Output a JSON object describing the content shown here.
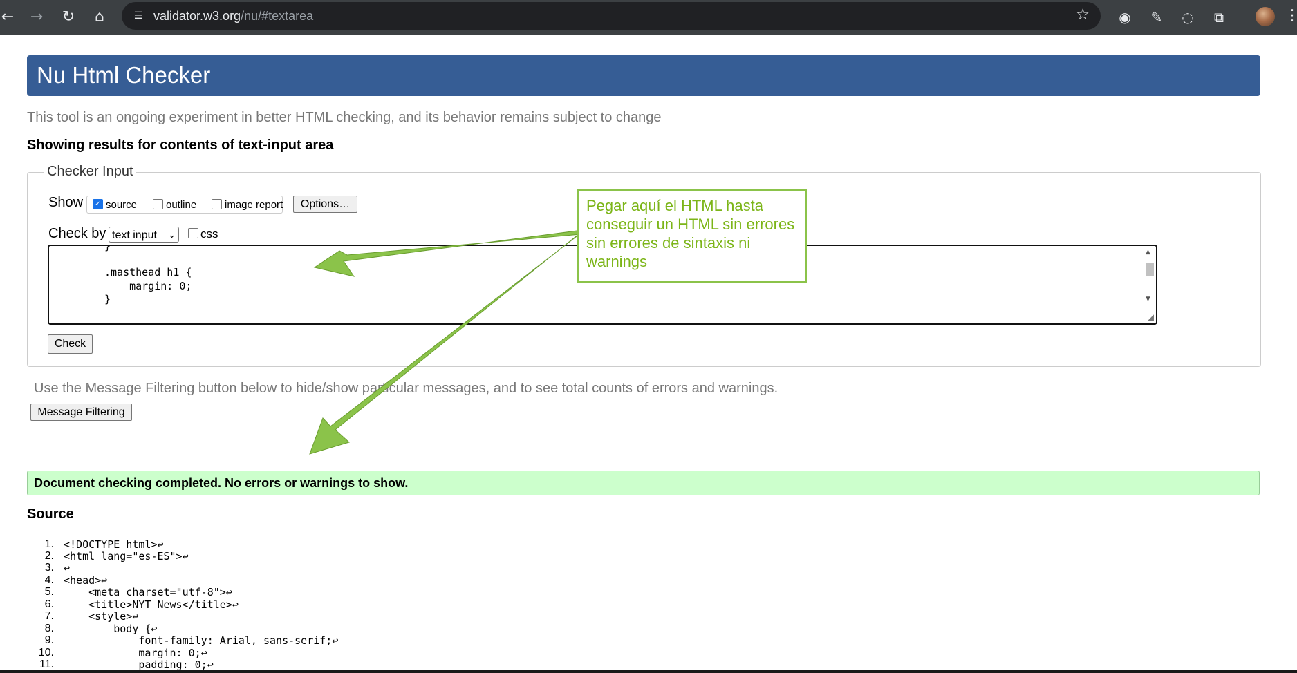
{
  "browser": {
    "url_domain": "validator.w3.org",
    "url_path": "/nu/#textarea",
    "icons": [
      "back-icon",
      "forward-icon",
      "reload-icon",
      "home-icon",
      "site-info-icon",
      "bookmark-star-icon",
      "camera-icon",
      "eyedropper-icon",
      "sync-icon",
      "extensions-icon",
      "profile-avatar",
      "menu-dots-icon"
    ]
  },
  "header": {
    "title": "Nu Html Checker"
  },
  "intro_text": "This tool is an ongoing experiment in better HTML checking, and its behavior remains subject to change",
  "results_heading": "Showing results for contents of text-input area",
  "checker_input": {
    "legend": "Checker Input",
    "show_label": "Show",
    "options": [
      {
        "label": "source",
        "checked": true
      },
      {
        "label": "outline",
        "checked": false
      },
      {
        "label": "image report",
        "checked": false
      }
    ],
    "options_button": "Options…",
    "check_by_label": "Check by",
    "check_by_value": "text input",
    "css_label": "css",
    "css_checked": false,
    "textarea_lines": [
      "}",
      "",
      ".masthead h1 {",
      "    margin: 0;",
      "}"
    ],
    "check_button": "Check"
  },
  "filter_text": "Use the Message Filtering button below to hide/show particular messages, and to see total counts of errors and warnings.",
  "message_filtering_button": "Message Filtering",
  "success_message": "Document checking completed. No errors or warnings to show.",
  "source_heading": "Source",
  "source_lines": [
    {
      "num": "1.",
      "text": "<!DOCTYPE html>↩"
    },
    {
      "num": "2.",
      "text": "<html lang=\"es-ES\">↩"
    },
    {
      "num": "3.",
      "text": "↩"
    },
    {
      "num": "4.",
      "text": "<head>↩"
    },
    {
      "num": "5.",
      "text": "    <meta charset=\"utf-8\">↩"
    },
    {
      "num": "6.",
      "text": "    <title>NYT News</title>↩"
    },
    {
      "num": "7.",
      "text": "    <style>↩"
    },
    {
      "num": "8.",
      "text": "        body {↩"
    },
    {
      "num": "9.",
      "text": "            font-family: Arial, sans-serif;↩"
    },
    {
      "num": "10.",
      "text": "            margin: 0;↩"
    },
    {
      "num": "11.",
      "text": "            padding: 0;↩"
    }
  ],
  "annotation": {
    "text": "Pegar aquí el HTML hasta conseguir un HTML sin errores sin errores de sintaxis ni warnings",
    "color": "#8bc34a"
  }
}
